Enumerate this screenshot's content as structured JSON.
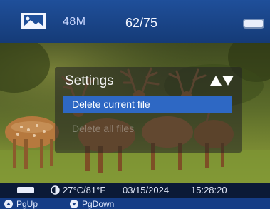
{
  "topbar": {
    "icon": "gallery-icon",
    "resolution": "48M",
    "counter": "62/75",
    "battery_icon": "battery-icon"
  },
  "menu": {
    "title": "Settings",
    "arrows_icon": "up-down-arrows-icon",
    "items": [
      {
        "label": "Delete current file",
        "state": "selected"
      },
      {
        "label": "Delete all files",
        "state": "disabled"
      }
    ]
  },
  "status": {
    "battery_icon": "battery-icon",
    "temperature_icon": "thermometer-icon",
    "temperature": "27°C/81°F",
    "date": "03/15/2024",
    "time": "15:28:20"
  },
  "nav": {
    "pgup": {
      "icon": "up-circle-icon",
      "label": "PgUp"
    },
    "pgdown": {
      "icon": "down-circle-icon",
      "label": "PgDown"
    }
  },
  "colors": {
    "accent": "#2e68c4",
    "topbar": "#1f4f9a",
    "navbar": "#153d86",
    "status_bg": "#0b1a36"
  }
}
